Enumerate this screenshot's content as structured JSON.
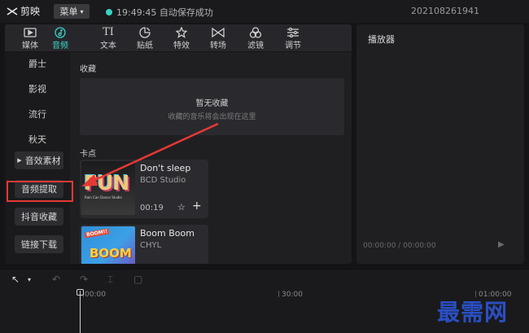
{
  "app": {
    "name": "剪映",
    "menu_label": "菜单",
    "save_status": "19:49:45 自动保存成功",
    "project_id": "202108261941"
  },
  "toolbar": {
    "items": [
      {
        "label": "媒体",
        "icon": "media-icon"
      },
      {
        "label": "音频",
        "icon": "audio-icon",
        "active": true
      },
      {
        "label": "文本",
        "icon": "text-icon",
        "glyph": "TI"
      },
      {
        "label": "贴纸",
        "icon": "sticker-icon"
      },
      {
        "label": "特效",
        "icon": "effects-icon"
      },
      {
        "label": "转场",
        "icon": "transition-icon"
      },
      {
        "label": "滤镜",
        "icon": "filter-icon"
      },
      {
        "label": "调节",
        "icon": "adjust-icon"
      }
    ]
  },
  "sidebar": {
    "categories": [
      "爵士",
      "影视",
      "流行",
      "秋天"
    ],
    "buttons": [
      "音效素材",
      "音频提取",
      "抖音收藏",
      "链接下载"
    ]
  },
  "content": {
    "favorites_title": "收藏",
    "empty_title": "暂无收藏",
    "empty_subtitle": "收藏的音乐将会出现在这里",
    "beats_title": "卡点",
    "tracks": [
      {
        "title": "Don't sleep",
        "artist": "BCD Studio",
        "duration": "00:19",
        "cover_text": "FUN",
        "cover_subtext": "Rain Can Dance Studio"
      },
      {
        "title": "Boom Boom",
        "artist": "CHYL",
        "cover_text": "BOOM",
        "cover_subtext": "BOOM!!"
      }
    ]
  },
  "player": {
    "title": "播放器",
    "time": "00:00:00 / 00:00:00"
  },
  "timeline": {
    "ticks": [
      "00:00",
      "30:00",
      "01:00:00"
    ]
  },
  "watermark": "最需网",
  "colors": {
    "accent": "#3bd3c6",
    "annotation": "#e53935",
    "watermark": "#2a4fc4"
  }
}
